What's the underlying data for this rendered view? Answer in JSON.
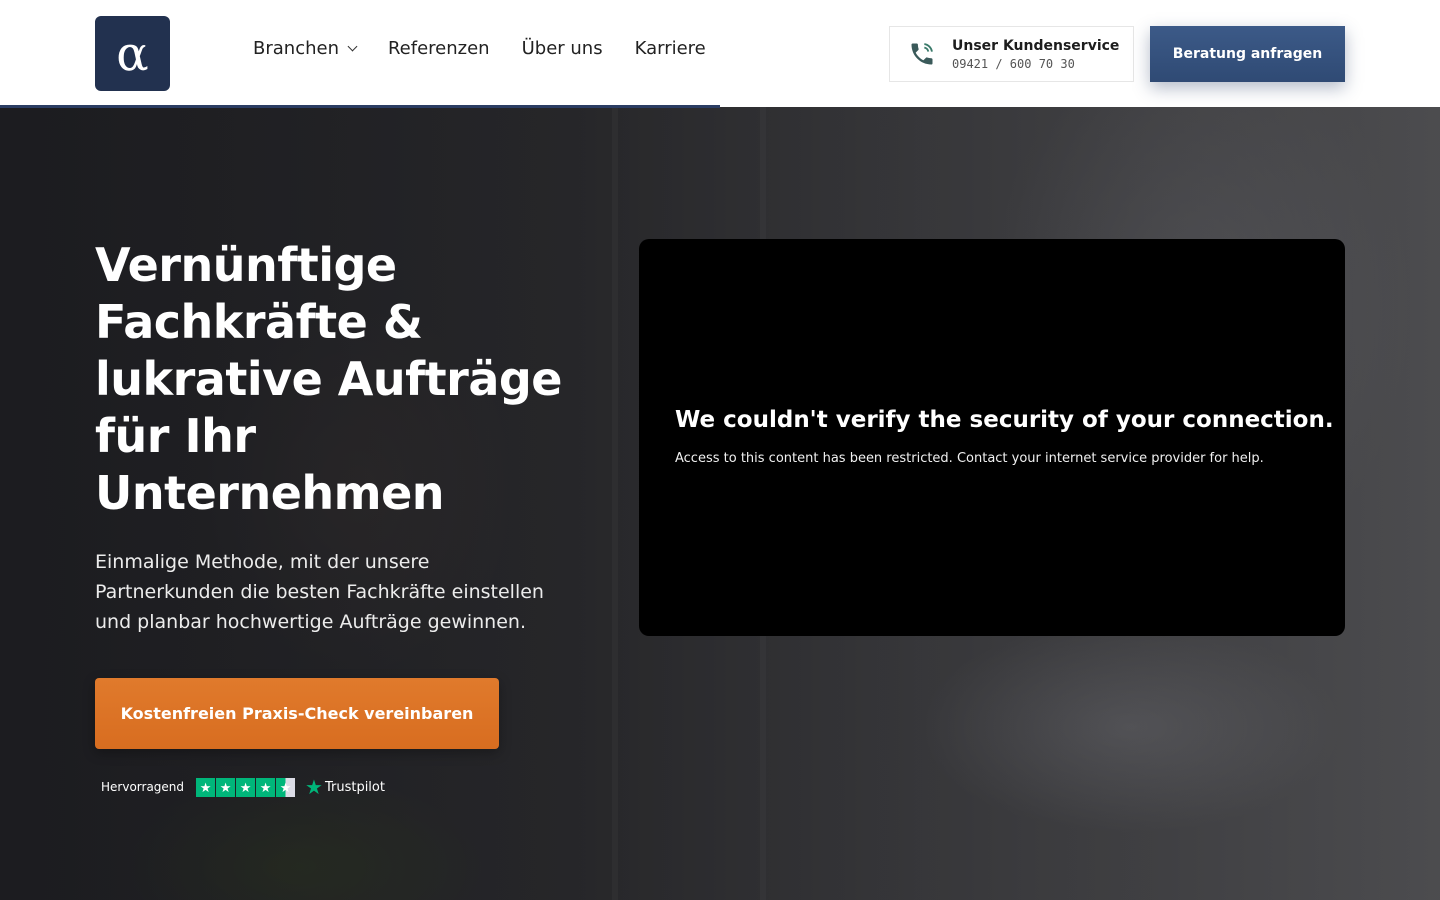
{
  "header": {
    "logo_glyph": "α",
    "nav": {
      "branchen": "Branchen",
      "referenzen": "Referenzen",
      "ueber_uns": "Über uns",
      "karriere": "Karriere"
    },
    "service": {
      "title": "Unser Kundenservice",
      "phone": "09421 / 600 70 30",
      "icon": "phone-icon"
    },
    "cta_label": "Beratung anfragen"
  },
  "hero": {
    "headline": "Vernünftige Fachkräfte & lukrative Aufträge für Ihr Unternehmen",
    "subline": "Einmalige Methode, mit der unsere Partnerkunden die besten Fachkräfte einstellen und planbar hochwertige Aufträge gewinnen.",
    "cta_label": "Kostenfreien Praxis-Check vereinbaren",
    "trust": {
      "rating_text": "Hervorragend",
      "stars": 4.5,
      "brand": "Trustpilot"
    }
  },
  "blocked_embed": {
    "title": "We couldn't verify the security of your connection.",
    "message": "Access to this content has been restricted. Contact your internet service provider for help."
  },
  "colors": {
    "brand_navy": "#22314f",
    "cta_blue": "#3c5a88",
    "cta_orange": "#e07a2c",
    "trustpilot_green": "#00b67a"
  }
}
